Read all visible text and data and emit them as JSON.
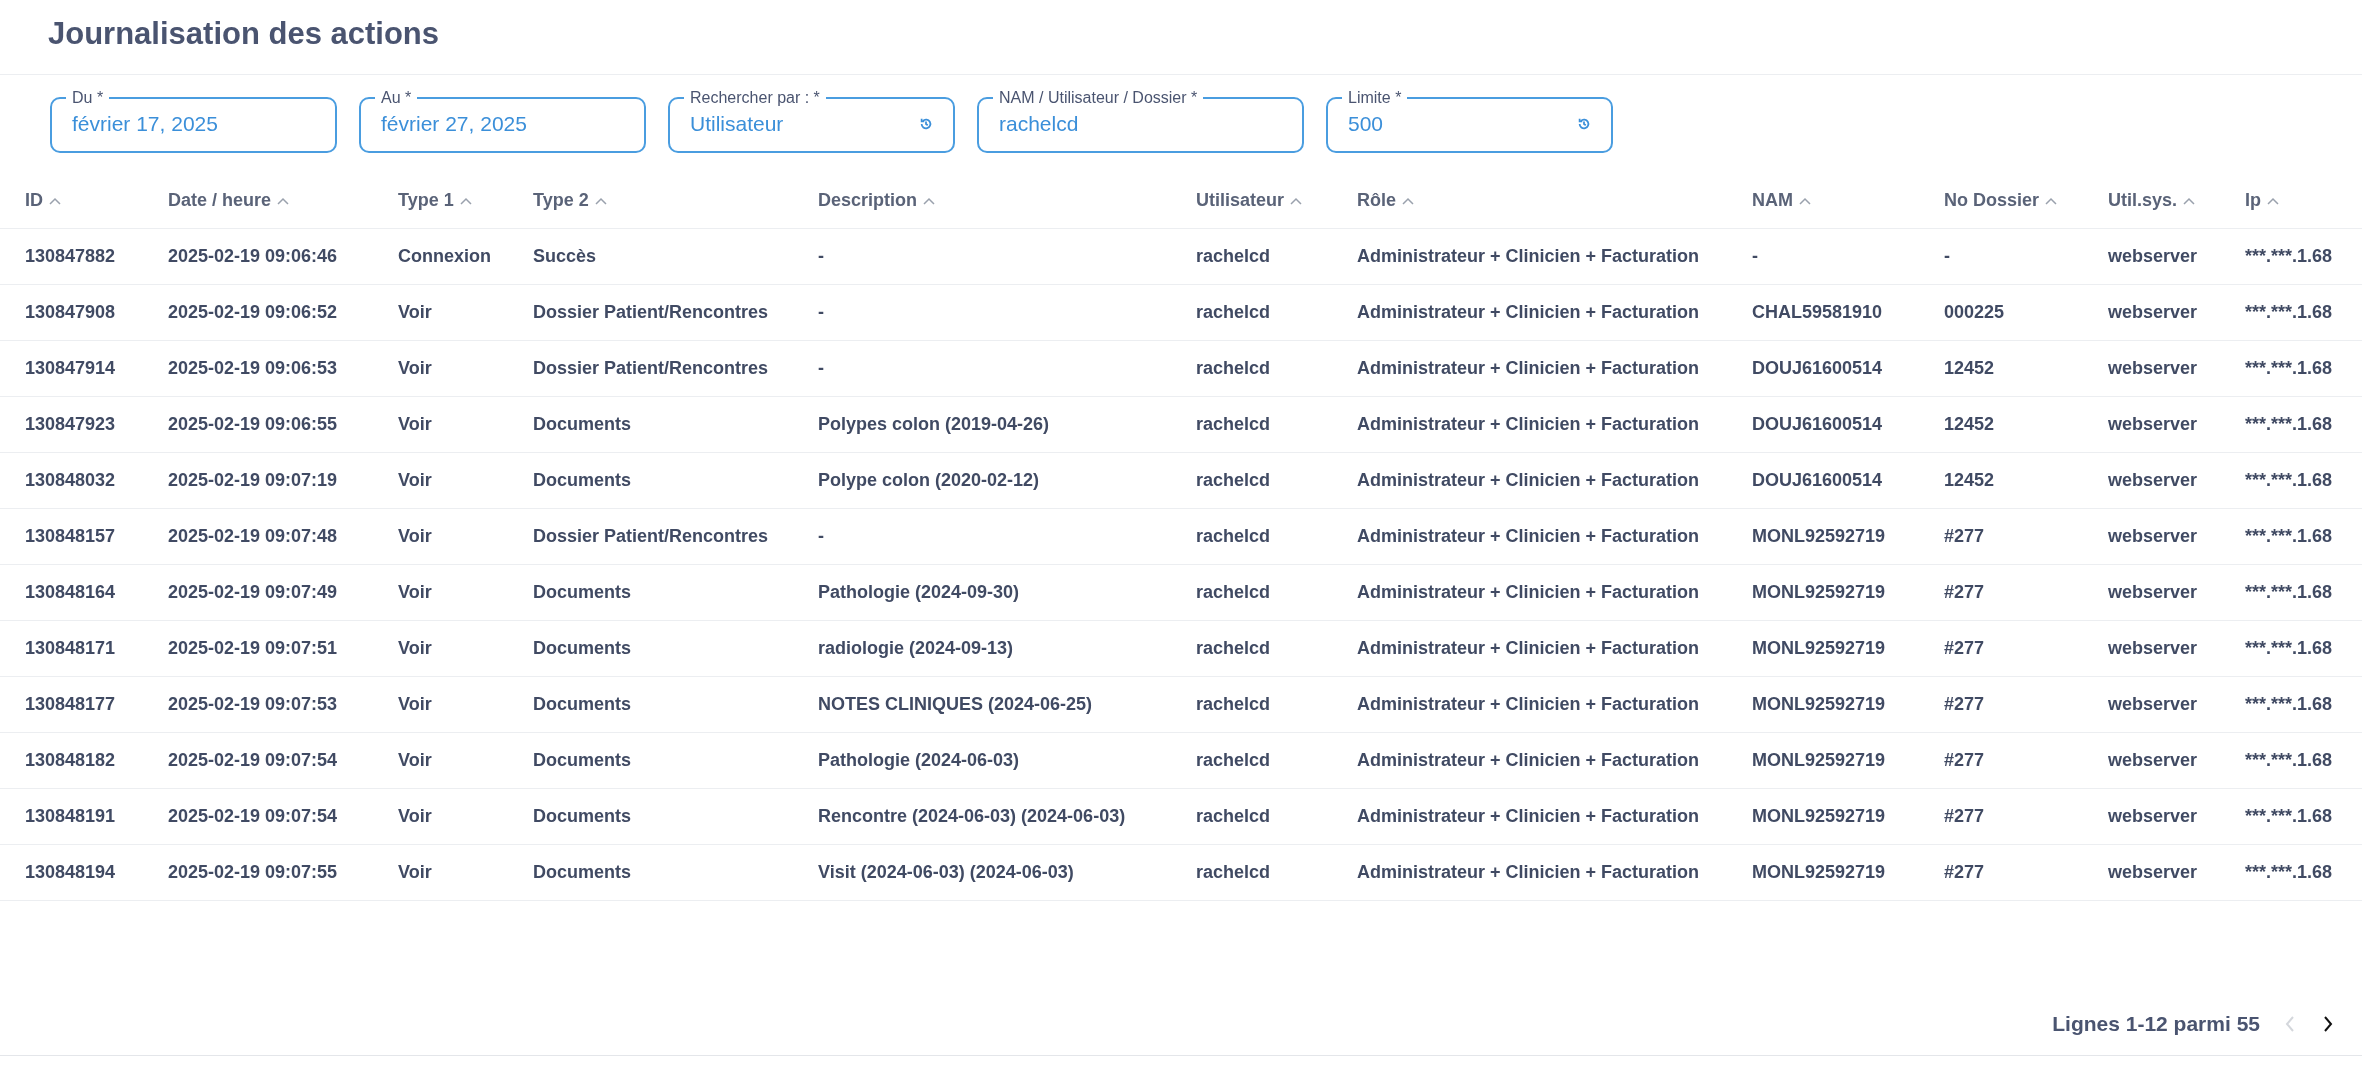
{
  "title": "Journalisation des actions",
  "filters": [
    {
      "label": "Du *",
      "value": "février 17, 2025",
      "has_reset": false
    },
    {
      "label": "Au *",
      "value": "février 27, 2025",
      "has_reset": false
    },
    {
      "label": "Rechercher par : *",
      "value": "Utilisateur",
      "has_reset": true
    },
    {
      "label": "NAM / Utilisateur / Dossier *",
      "value": "rachelcd",
      "has_reset": false
    },
    {
      "label": "Limite *",
      "value": "500",
      "has_reset": true
    }
  ],
  "table": {
    "columns": [
      "ID",
      "Date / heure",
      "Type 1",
      "Type 2",
      "Description",
      "Utilisateur",
      "Rôle",
      "NAM",
      "No Dossier",
      "Util.sys.",
      "Ip"
    ],
    "rows": [
      [
        "130847882",
        "2025-02-19 09:06:46",
        "Connexion",
        "Succès",
        "-",
        "rachelcd",
        "Administrateur + Clinicien + Facturation",
        "-",
        "-",
        "webserver",
        "***.***.1.68"
      ],
      [
        "130847908",
        "2025-02-19 09:06:52",
        "Voir",
        "Dossier Patient/Rencontres",
        "-",
        "rachelcd",
        "Administrateur + Clinicien + Facturation",
        "CHAL59581910",
        "000225",
        "webserver",
        "***.***.1.68"
      ],
      [
        "130847914",
        "2025-02-19 09:06:53",
        "Voir",
        "Dossier Patient/Rencontres",
        "-",
        "rachelcd",
        "Administrateur + Clinicien + Facturation",
        "DOUJ61600514",
        "12452",
        "webserver",
        "***.***.1.68"
      ],
      [
        "130847923",
        "2025-02-19 09:06:55",
        "Voir",
        "Documents",
        "Polypes colon (2019-04-26)",
        "rachelcd",
        "Administrateur + Clinicien + Facturation",
        "DOUJ61600514",
        "12452",
        "webserver",
        "***.***.1.68"
      ],
      [
        "130848032",
        "2025-02-19 09:07:19",
        "Voir",
        "Documents",
        "Polype colon (2020-02-12)",
        "rachelcd",
        "Administrateur + Clinicien + Facturation",
        "DOUJ61600514",
        "12452",
        "webserver",
        "***.***.1.68"
      ],
      [
        "130848157",
        "2025-02-19 09:07:48",
        "Voir",
        "Dossier Patient/Rencontres",
        "-",
        "rachelcd",
        "Administrateur + Clinicien + Facturation",
        "MONL92592719",
        "#277",
        "webserver",
        "***.***.1.68"
      ],
      [
        "130848164",
        "2025-02-19 09:07:49",
        "Voir",
        "Documents",
        "Pathologie (2024-09-30)",
        "rachelcd",
        "Administrateur + Clinicien + Facturation",
        "MONL92592719",
        "#277",
        "webserver",
        "***.***.1.68"
      ],
      [
        "130848171",
        "2025-02-19 09:07:51",
        "Voir",
        "Documents",
        "radiologie (2024-09-13)",
        "rachelcd",
        "Administrateur + Clinicien + Facturation",
        "MONL92592719",
        "#277",
        "webserver",
        "***.***.1.68"
      ],
      [
        "130848177",
        "2025-02-19 09:07:53",
        "Voir",
        "Documents",
        "NOTES CLINIQUES (2024-06-25)",
        "rachelcd",
        "Administrateur + Clinicien + Facturation",
        "MONL92592719",
        "#277",
        "webserver",
        "***.***.1.68"
      ],
      [
        "130848182",
        "2025-02-19 09:07:54",
        "Voir",
        "Documents",
        "Pathologie (2024-06-03)",
        "rachelcd",
        "Administrateur + Clinicien + Facturation",
        "MONL92592719",
        "#277",
        "webserver",
        "***.***.1.68"
      ],
      [
        "130848191",
        "2025-02-19 09:07:54",
        "Voir",
        "Documents",
        "Rencontre (2024-06-03) (2024-06-03)",
        "rachelcd",
        "Administrateur + Clinicien + Facturation",
        "MONL92592719",
        "#277",
        "webserver",
        "***.***.1.68"
      ],
      [
        "130848194",
        "2025-02-19 09:07:55",
        "Voir",
        "Documents",
        "Visit (2024-06-03) (2024-06-03)",
        "rachelcd",
        "Administrateur + Clinicien + Facturation",
        "MONL92592719",
        "#277",
        "webserver",
        "***.***.1.68"
      ]
    ]
  },
  "pagination": {
    "text": "Lignes 1-12 parmi 55",
    "previous": {
      "disabled": true
    },
    "next": {
      "disabled": false
    }
  }
}
